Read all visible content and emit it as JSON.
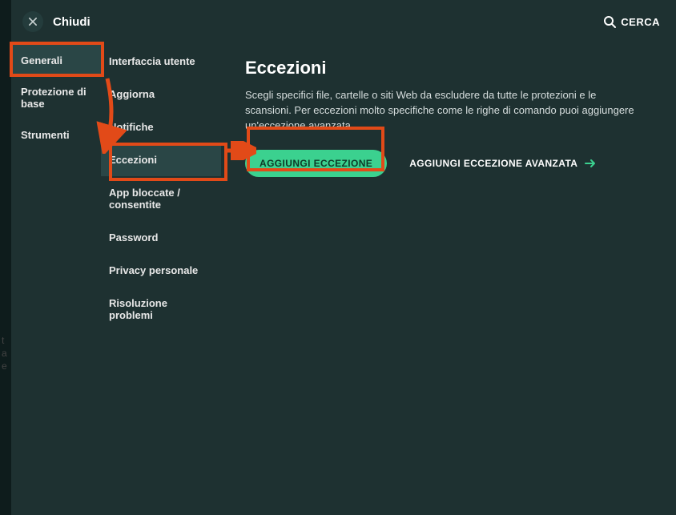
{
  "header": {
    "close_label": "Chiudi",
    "search_label": "CERCA"
  },
  "col1": {
    "items": [
      {
        "label": "Generali",
        "selected": true
      },
      {
        "label": "Protezione di base",
        "selected": false
      },
      {
        "label": "Strumenti",
        "selected": false
      }
    ]
  },
  "col2": {
    "items": [
      {
        "label": "Interfaccia utente",
        "selected": false
      },
      {
        "label": "Aggiorna",
        "selected": false
      },
      {
        "label": "Notifiche",
        "selected": false
      },
      {
        "label": "Eccezioni",
        "selected": true
      },
      {
        "label": "App bloccate / consentite",
        "selected": false
      },
      {
        "label": "Password",
        "selected": false
      },
      {
        "label": "Privacy personale",
        "selected": false
      },
      {
        "label": "Risoluzione problemi",
        "selected": false
      }
    ]
  },
  "content": {
    "title": "Eccezioni",
    "description": "Scegli specifici file, cartelle o siti Web da escludere da tutte le protezioni e le scansioni. Per eccezioni molto specifiche come le righe di comando puoi aggiungere un'eccezione avanzata.",
    "primary_btn": "AGGIUNGI ECCEZIONE",
    "secondary_btn": "AGGIUNGI ECCEZIONE AVANZATA"
  },
  "ghosts": {
    "a": "t",
    "b": "a",
    "c": "e"
  },
  "colors": {
    "accent": "#3bd18f",
    "annotation": "#e24a18",
    "bg": "#1e3131"
  }
}
